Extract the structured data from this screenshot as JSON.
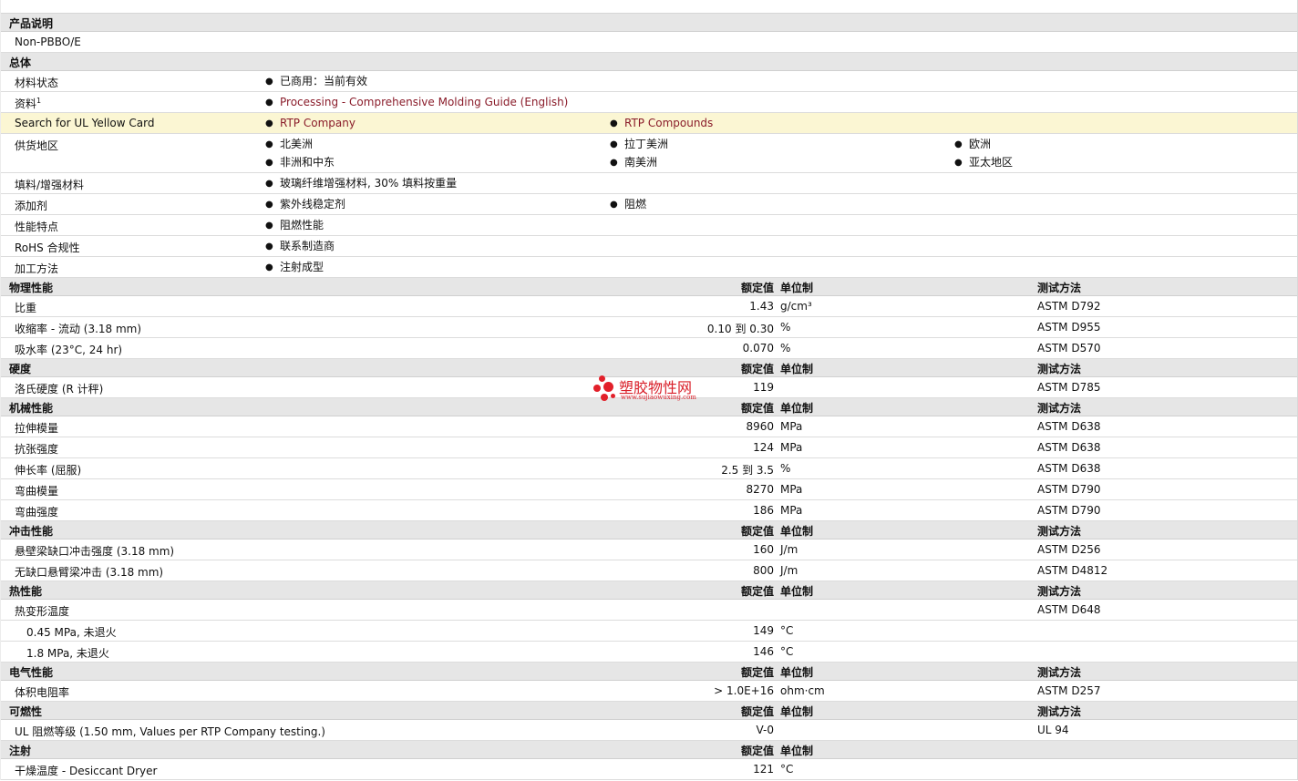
{
  "general": {
    "title": "产品说明",
    "description": "Non-PBBO/E",
    "overall_title": "总体",
    "rows": [
      {
        "label": "材料状态",
        "items": [
          "已商用：当前有效"
        ],
        "links": false
      },
      {
        "label": "资料",
        "sup": "1",
        "items": [
          "Processing - Comprehensive Molding Guide (English)"
        ],
        "links": true
      },
      {
        "label": "Search for UL Yellow Card",
        "items": [
          "RTP Company",
          "RTP Compounds"
        ],
        "links": true,
        "highlight": true
      },
      {
        "label": "供货地区",
        "items": [
          "北美洲",
          "拉丁美洲",
          "欧洲",
          "非洲和中东",
          "南美洲",
          "亚太地区"
        ],
        "links": false
      },
      {
        "label": "填料/增强材料",
        "items": [
          "玻璃纤维增强材料, 30% 填料按重量"
        ],
        "links": false
      },
      {
        "label": "添加剂",
        "items": [
          "紫外线稳定剂",
          "阻燃"
        ],
        "links": false
      },
      {
        "label": "性能特点",
        "items": [
          "阻燃性能"
        ],
        "links": false
      },
      {
        "label": "RoHS 合规性",
        "items": [
          "联系制造商"
        ],
        "links": false
      },
      {
        "label": "加工方法",
        "items": [
          "注射成型"
        ],
        "links": false
      }
    ]
  },
  "headers": {
    "nominal": "额定值",
    "unit": "单位制",
    "test": "测试方法"
  },
  "sections": [
    {
      "title": "物理性能",
      "show_test": true,
      "rows": [
        {
          "label": "比重",
          "value": "1.43",
          "unit": "g/cm³",
          "test": "ASTM D792"
        },
        {
          "label": "收缩率  - 流动  (3.18 mm)",
          "value": "0.10 到  0.30",
          "unit": "%",
          "test": "ASTM D955"
        },
        {
          "label": "吸水率  (23°C, 24 hr)",
          "value": "0.070",
          "unit": "%",
          "test": "ASTM D570"
        }
      ]
    },
    {
      "title": "硬度",
      "show_test": true,
      "rows": [
        {
          "label": "洛氏硬度  (R 计秤)",
          "value": "119",
          "unit": "",
          "test": "ASTM D785"
        }
      ]
    },
    {
      "title": "机械性能",
      "show_test": true,
      "rows": [
        {
          "label": "拉伸模量",
          "value": "8960",
          "unit": "MPa",
          "test": "ASTM D638"
        },
        {
          "label": "抗张强度",
          "value": "124",
          "unit": "MPa",
          "test": "ASTM D638"
        },
        {
          "label": "伸长率  (屈服)",
          "value": "2.5 到  3.5",
          "unit": "%",
          "test": "ASTM D638"
        },
        {
          "label": "弯曲模量",
          "value": "8270",
          "unit": "MPa",
          "test": "ASTM D790"
        },
        {
          "label": "弯曲强度",
          "value": "186",
          "unit": "MPa",
          "test": "ASTM D790"
        }
      ]
    },
    {
      "title": "冲击性能",
      "show_test": true,
      "rows": [
        {
          "label": "悬壁梁缺口冲击强度  (3.18 mm)",
          "value": "160",
          "unit": "J/m",
          "test": "ASTM D256"
        },
        {
          "label": "无缺口悬臂梁冲击  (3.18 mm)",
          "value": "800",
          "unit": "J/m",
          "test": "ASTM D4812"
        }
      ]
    },
    {
      "title": "热性能",
      "show_test": true,
      "rows": [
        {
          "label": "热变形温度",
          "value": "",
          "unit": "",
          "test": "ASTM D648"
        },
        {
          "label": "0.45 MPa, 未退火",
          "value": "149",
          "unit": "°C",
          "test": "",
          "indent": true
        },
        {
          "label": "1.8 MPa, 未退火",
          "value": "146",
          "unit": "°C",
          "test": "",
          "indent": true
        }
      ]
    },
    {
      "title": "电气性能",
      "show_test": true,
      "rows": [
        {
          "label": "体积电阻率",
          "value": "> 1.0E+16",
          "unit": "ohm·cm",
          "test": "ASTM D257"
        }
      ]
    },
    {
      "title": "可燃性",
      "show_test": true,
      "rows": [
        {
          "label": "UL 阻燃等级  (1.50 mm, Values per RTP Company testing.)",
          "value": "V-0",
          "unit": "",
          "test": "UL 94"
        }
      ]
    },
    {
      "title": "注射",
      "show_test": false,
      "rows": [
        {
          "label": "干燥温度  - Desiccant Dryer",
          "value": "121",
          "unit": "°C",
          "test": ""
        }
      ]
    }
  ],
  "watermark": {
    "name": "塑胶物性网",
    "url": "www.sujiaowuxing.com",
    "color": "#e2202a"
  }
}
